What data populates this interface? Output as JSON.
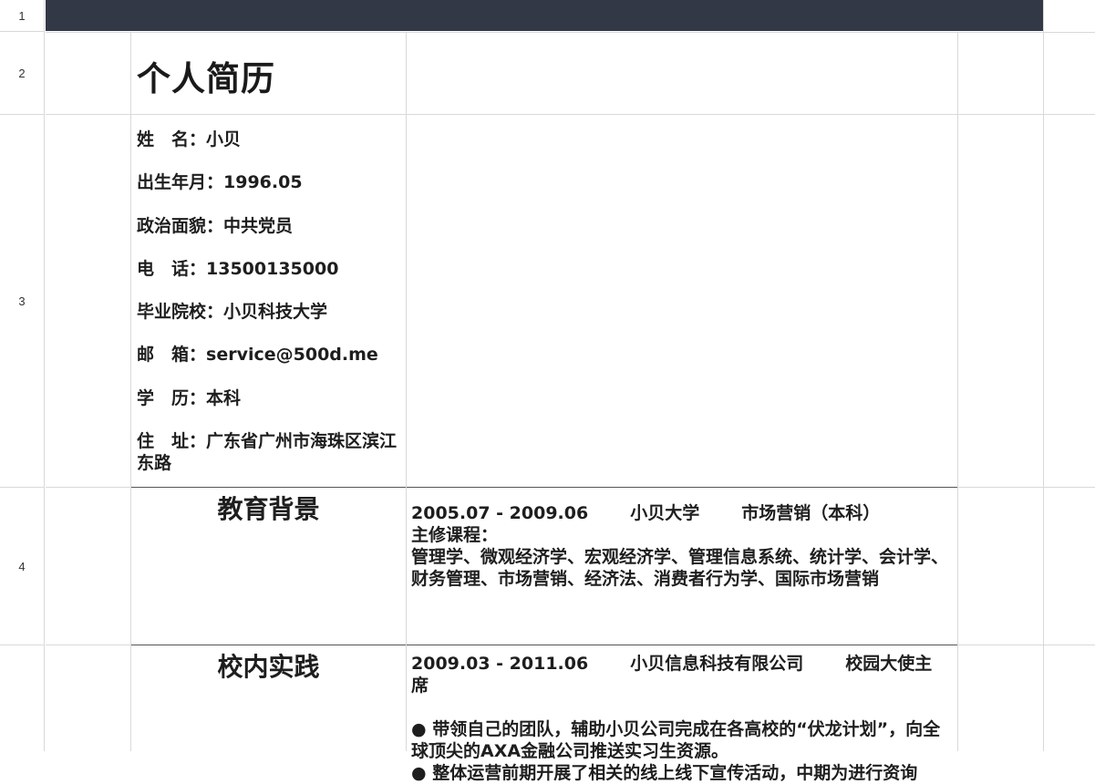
{
  "row_numbers": [
    "1",
    "2",
    "3",
    "4"
  ],
  "resume": {
    "title": "个人简历",
    "info": [
      {
        "key": "姓　名：",
        "value": "小贝"
      },
      {
        "key": "出生年月：",
        "value": "1996.05"
      },
      {
        "key": "政治面貌：",
        "value": "中共党员"
      },
      {
        "key": "电　话：",
        "value": "13500135000"
      },
      {
        "key": "毕业院校：",
        "value": "小贝科技大学"
      },
      {
        "key": "邮　箱：",
        "value": "service@500d.me"
      },
      {
        "key": "学　历：",
        "value": "本科"
      },
      {
        "key": "住　址：",
        "value": "广东省广州市海珠区滨江东路"
      }
    ],
    "education": {
      "heading": "教育背景",
      "period": "2005.07 - 2009.06",
      "school": "小贝大学",
      "major": "市场营销（本科）",
      "courses_label": "主修课程：",
      "courses": "管理学、微观经济学、宏观经济学、管理信息系统、统计学、会计学、财务管理、市场营销、经济法、消费者行为学、国际市场营销"
    },
    "practice": {
      "heading": "校内实践",
      "period": "2009.03 - 2011.06",
      "company": "小贝信息科技有限公司",
      "role": "校园大使主席",
      "bullets": [
        "● 带领自己的团队，辅助小贝公司完成在各高校的“伏龙计划”，向全球顶尖的AXA金融公司推送实习生资源。",
        "● 整体运营前期开展了相关的线上线下宣传活动，中期为进行资询"
      ]
    }
  }
}
